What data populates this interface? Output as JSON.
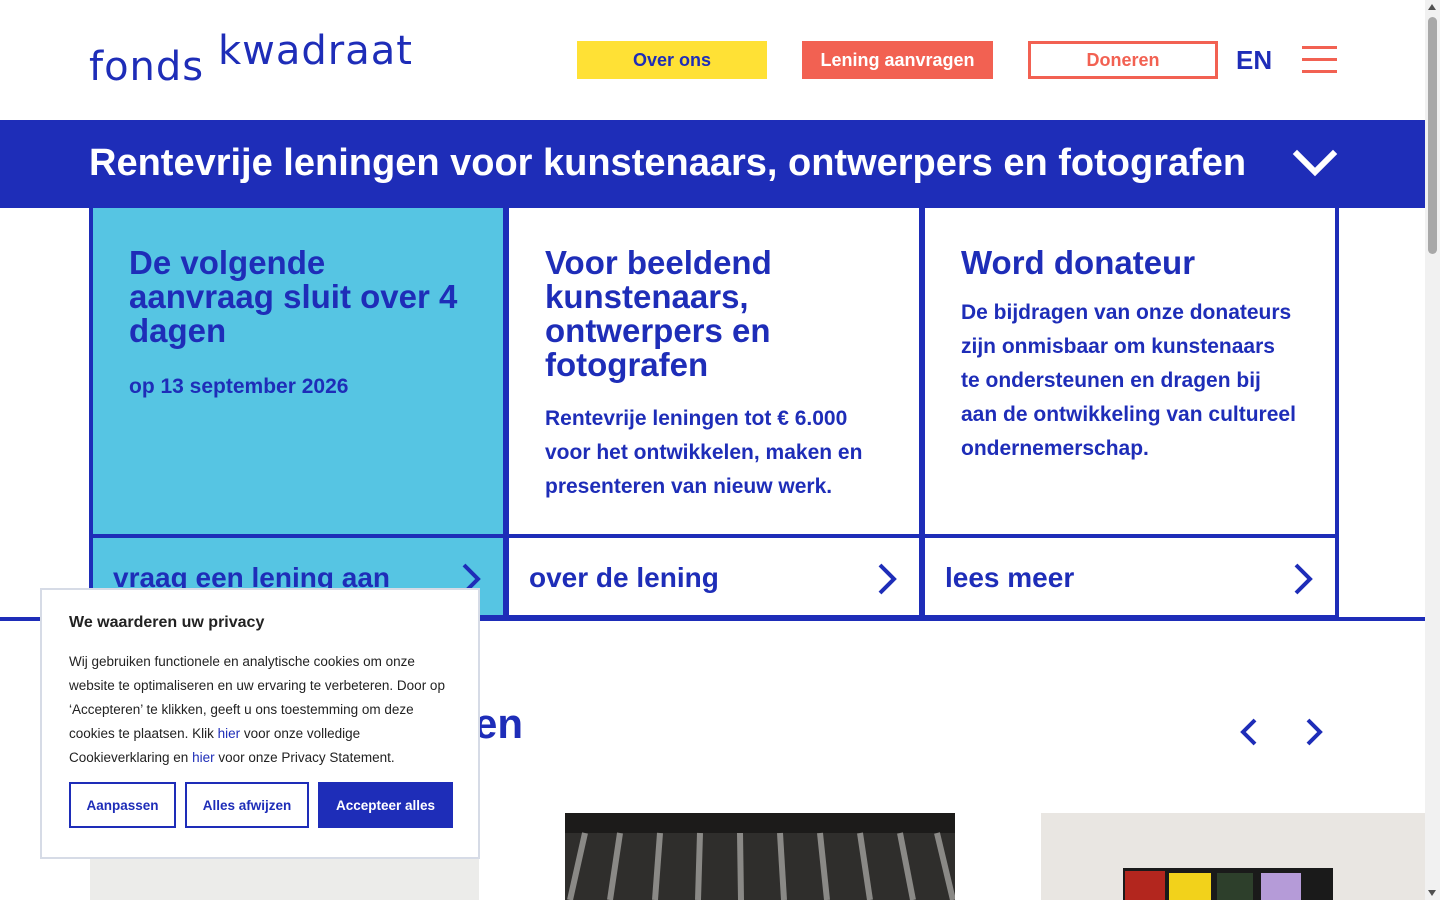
{
  "header": {
    "logo_word1": "fonds",
    "logo_word2": "kwadraat",
    "over_ons": "Over ons",
    "lening_aanvragen": "Lening aanvragen",
    "doneren": "Doneren",
    "language": "EN",
    "menu_icon": "hamburger-icon"
  },
  "banner": {
    "title": "Rentevrije leningen voor kunstenaars, ontwerpers en fotografen",
    "icon": "chevron-down-icon"
  },
  "cards": [
    {
      "title": "De volgende aanvraag sluit over 4 dagen",
      "subtitle": "op 13 september 2026",
      "link": "vraag een lening aan"
    },
    {
      "title": "Voor beeldend kunstenaars, ontwerpers en fotografen",
      "subtitle": "Rentevrije leningen tot € 6.000 voor het ontwikkelen, maken en presenteren van nieuw werk.",
      "link": "over de lening"
    },
    {
      "title": "Word donateur",
      "subtitle": "De bijdragen van onze donateurs zijn onmisbaar om kunstenaars te ondersteunen en dragen bij aan de ontwikkeling van cultureel ondernemerschap.",
      "link": "lees meer"
    }
  ],
  "section": {
    "title_visible_fragment": "en"
  },
  "cookie": {
    "title": "We waarderen uw privacy",
    "text_part1": "Wij gebruiken functionele en analytische cookies om onze website te optimaliseren en uw ervaring te verbeteren. Door op ‘Accepteren’ te klikken, geeft u ons toestemming om deze cookies te plaatsen. Klik ",
    "link1": "hier",
    "text_part2": " voor onze volledige Cookieverklaring en ",
    "link2": "hier",
    "text_part3": " voor onze Privacy Statement.",
    "btn_customize": "Aanpassen",
    "btn_reject": "Alles afwijzen",
    "btn_accept": "Accepteer alles"
  },
  "colors": {
    "brand_blue": "#1e2db8",
    "yellow": "#ffe135",
    "coral": "#f26152",
    "light_blue": "#56c5e3"
  }
}
